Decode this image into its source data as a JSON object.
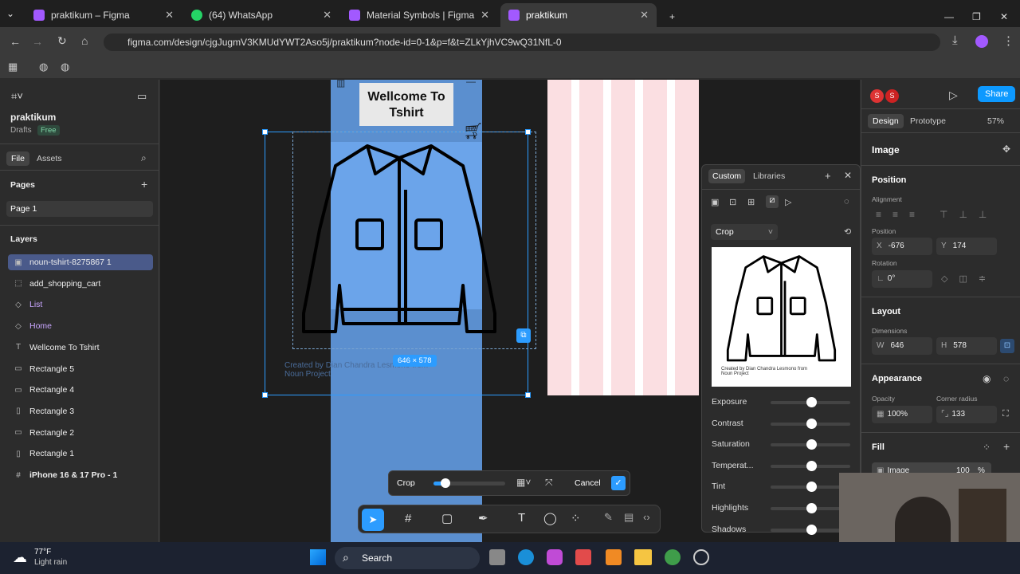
{
  "browser": {
    "tabs": [
      {
        "label": "praktikum – Figma",
        "color": "#a259ff"
      },
      {
        "label": "(64) WhatsApp",
        "color": "#25d366"
      },
      {
        "label": "Material Symbols | Figma",
        "color": "#a259ff"
      },
      {
        "label": "praktikum",
        "color": "#a259ff"
      }
    ],
    "url": "figma.com/design/cjgJugmV3KMUdYWT2Aso5j/praktikum?node-id=0-1&p=f&t=ZLkYjhVC9wQ31NfL-0"
  },
  "file": {
    "name": "praktikum",
    "location": "Drafts",
    "plan": "Free"
  },
  "left_tabs": {
    "file": "File",
    "assets": "Assets"
  },
  "pages": {
    "title": "Pages",
    "items": [
      "Page 1"
    ]
  },
  "layers": {
    "title": "Layers",
    "items": [
      {
        "icon": "▣",
        "label": "noun-tshirt-8275867 1"
      },
      {
        "icon": "⬚",
        "label": "add_shopping_cart"
      },
      {
        "icon": "◇",
        "label": "List"
      },
      {
        "icon": "◇",
        "label": "Home"
      },
      {
        "icon": "T",
        "label": "Wellcome To Tshirt"
      },
      {
        "icon": "▭",
        "label": "Rectangle 5"
      },
      {
        "icon": "▭",
        "label": "Rectangle 4"
      },
      {
        "icon": "▯",
        "label": "Rectangle 3"
      },
      {
        "icon": "▭",
        "label": "Rectangle 2"
      },
      {
        "icon": "▯",
        "label": "Rectangle 1"
      },
      {
        "icon": "#",
        "label": "iPhone 16 & 17 Pro - 1"
      }
    ]
  },
  "canvas": {
    "frame_title": "Wellcome To Tshirt",
    "dimension_badge": "646 × 578",
    "credit_text": "Created by Dian Chandra Lesmono from Noun Project",
    "crop_toolbar": {
      "label": "Crop",
      "cancel": "Cancel",
      "confirm": "✓"
    }
  },
  "crop_panel": {
    "tabs": [
      "Custom",
      "Libraries"
    ],
    "mode": "Crop",
    "credit": "Created by Dian Chandra Lesmono from Noun Project",
    "adjustments": [
      "Exposure",
      "Contrast",
      "Saturation",
      "Temperat...",
      "Tint",
      "Highlights",
      "Shadows"
    ]
  },
  "right": {
    "avatars": [
      "S",
      "S"
    ],
    "share": "Share",
    "tabs": {
      "design": "Design",
      "prototype": "Prototype",
      "zoom": "57%"
    },
    "section_title": "Image",
    "position": {
      "title": "Position",
      "alignment": "Alignment",
      "pos_label": "Position",
      "x_key": "X",
      "x": "-676",
      "y_key": "Y",
      "y": "174",
      "rotation_label": "Rotation",
      "rotation": "0°"
    },
    "layout": {
      "title": "Layout",
      "dims_label": "Dimensions",
      "w_key": "W",
      "w": "646",
      "h_key": "H",
      "h": "578"
    },
    "appearance": {
      "title": "Appearance",
      "opacity_label": "Opacity",
      "opacity": "100%",
      "radius_label": "Corner radius",
      "radius": "133"
    },
    "fill": {
      "title": "Fill",
      "type": "Image",
      "value": "100",
      "unit": "%"
    }
  },
  "taskbar": {
    "temp": "77°F",
    "weather": "Light rain",
    "search": "Search"
  }
}
